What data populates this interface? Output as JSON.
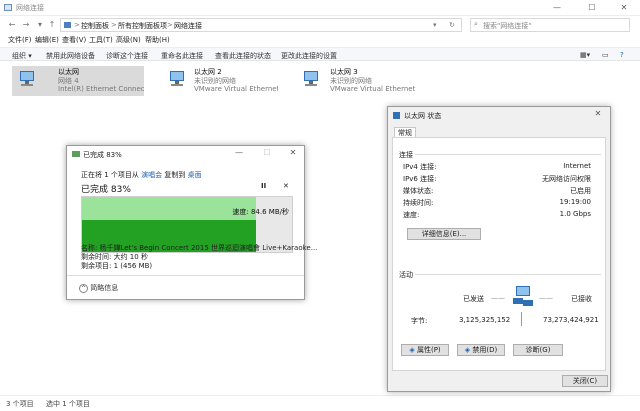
{
  "window": {
    "title": "网络连接",
    "minimize": "—",
    "maximize": "☐",
    "close": "✕"
  },
  "address": {
    "crumbs": [
      "控制面板",
      "所有控制面板项",
      "网络连接"
    ],
    "sep": ">"
  },
  "search": {
    "placeholder": "搜索\"网络连接\""
  },
  "menu": [
    "文件(F)",
    "编辑(E)",
    "查看(V)",
    "工具(T)",
    "高级(N)",
    "帮助(H)"
  ],
  "commands": [
    "组织 ▾",
    "禁用此网络设备",
    "诊断这个连接",
    "重命名此连接",
    "查看此连接的状态",
    "更改此连接的设置"
  ],
  "adapters": [
    {
      "name": "以太网",
      "status": "网络 4",
      "device": "Intel(R) Ethernet Connec..."
    },
    {
      "name": "以太网 2",
      "status": "未识别的网络",
      "device": "VMware Virtual Ethernet..."
    },
    {
      "name": "以太网 3",
      "status": "未识别的网络",
      "device": "VMware Virtual Ethernet..."
    }
  ],
  "statusbar": {
    "count": "3 个项目",
    "selected": "选中 1 个项目"
  },
  "copy": {
    "title": "已完成 83%",
    "line1_prefix": "正在将 1 个项目从",
    "from": "演唱会",
    "line1_mid": "复制到",
    "to": "桌面",
    "percent_text": "已完成 83%",
    "progress": 0.83,
    "speed": "速度: 84.6 MB/秒",
    "name": "名称: 杨千嬅Let's Begin Concert 2015 世界巡迴演唱會 Live+Karaoke...",
    "remaining_time": "剩余时间: 大约 10 秒",
    "remaining_items": "剩余项目: 1 (456 MB)",
    "less": "简略信息",
    "pause": "II",
    "stop": "✕"
  },
  "status": {
    "title": "以太网 状态",
    "tab": "常规",
    "group_conn": "连接",
    "rows": [
      {
        "label": "IPv4 连接:",
        "value": "Internet"
      },
      {
        "label": "IPv6 连接:",
        "value": "无网络访问权限"
      },
      {
        "label": "媒体状态:",
        "value": "已启用"
      },
      {
        "label": "持续时间:",
        "value": "19:19:00"
      },
      {
        "label": "速度:",
        "value": "1.0 Gbps"
      }
    ],
    "details_btn": "详细信息(E)...",
    "group_activity": "活动",
    "sent_label": "已发送",
    "recv_label": "已接收",
    "bytes_label": "字节:",
    "sent": "3,125,325,152",
    "recv": "73,273,424,921",
    "props_btn": "属性(P)",
    "disable_btn": "禁用(D)",
    "diag_btn": "诊断(G)",
    "close_btn": "关闭(C)"
  },
  "colors": {
    "done": "#9be39b",
    "speed": "#23a123",
    "link": "#1a5fb4"
  }
}
